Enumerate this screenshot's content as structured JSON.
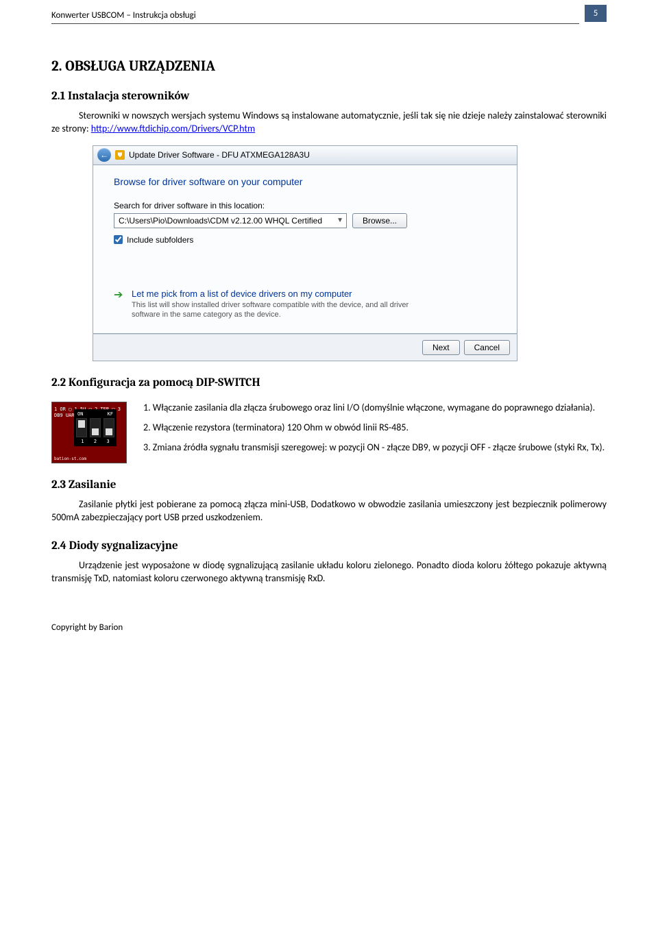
{
  "header": {
    "title": "Konwerter USBCOM – Instrukcja obsługi",
    "page_number": "5"
  },
  "sec2": {
    "h1_num": "2.",
    "h1_text": "OBSŁUGA URZĄDZENIA"
  },
  "sec2_1": {
    "heading": "2.1  Instalacja sterowników",
    "para": "Sterowniki w nowszych wersjach systemu Windows są instalowane automatycznie, jeśli tak się nie dzieje należy zainstalować sterowniki ze strony: ",
    "link": "http://www.ftdichip.com/Drivers/VCP.htm"
  },
  "dialog": {
    "title": "Update Driver Software - DFU ATXMEGA128A3U",
    "heading": "Browse for driver software on your computer",
    "search_label": "Search for driver software in this location:",
    "location": "C:\\Users\\Pio\\Downloads\\CDM v2.12.00 WHQL Certified",
    "browse": "Browse...",
    "include_sub": "Include subfolders",
    "option_title": "Let me pick from a list of device drivers on my computer",
    "option_desc": "This list will show installed driver software compatible with the device, and all driver software in the same category as the device.",
    "next": "Next",
    "cancel": "Cancel"
  },
  "sec2_2": {
    "heading": "2.2  Konfiguracja za pomocą DIP-SWITCH",
    "item1": "1. Włączanie zasilania dla złącza śrubowego oraz lini I/O (domyślnie włączone, wymagane do poprawnego działania).",
    "item2": "2. Włączenie rezystora (terminatora) 120 Ohm w obwód linii RS-485.",
    "item3": "3. Zmiana źródła sygnału transmisji szeregowej: w pozycji ON - złącze DB9, w pozycji OFF - złącze śrubowe (styki Rx, Tx)."
  },
  "sec2_3": {
    "heading": "2.3  Zasilanie",
    "para": "Zasilanie płytki jest pobierane za pomocą złącza mini-USB, Dodatkowo w obwodzie zasilania umieszczony jest bezpiecznik polimerowy 500mA zabezpieczający port USB przed uszkodzeniem."
  },
  "sec2_4": {
    "heading": "2.4  Diody sygnalizacyjne",
    "para": "Urządzenie jest wyposażone w diodę sygnalizującą zasilanie układu koloru zielonego. Ponadto dioda koloru żółtego pokazuje aktywną transmisję TxD, natomiast koloru czerwonego aktywną transmisję RxD."
  },
  "footer": {
    "text": "Copyright by Barion"
  },
  "dip_left_labels": "1 OR ▢\n1 5U ▢\n2 TER ▢\n3 DB9 UART",
  "dip_on": "ON",
  "dip_kf": "KF"
}
